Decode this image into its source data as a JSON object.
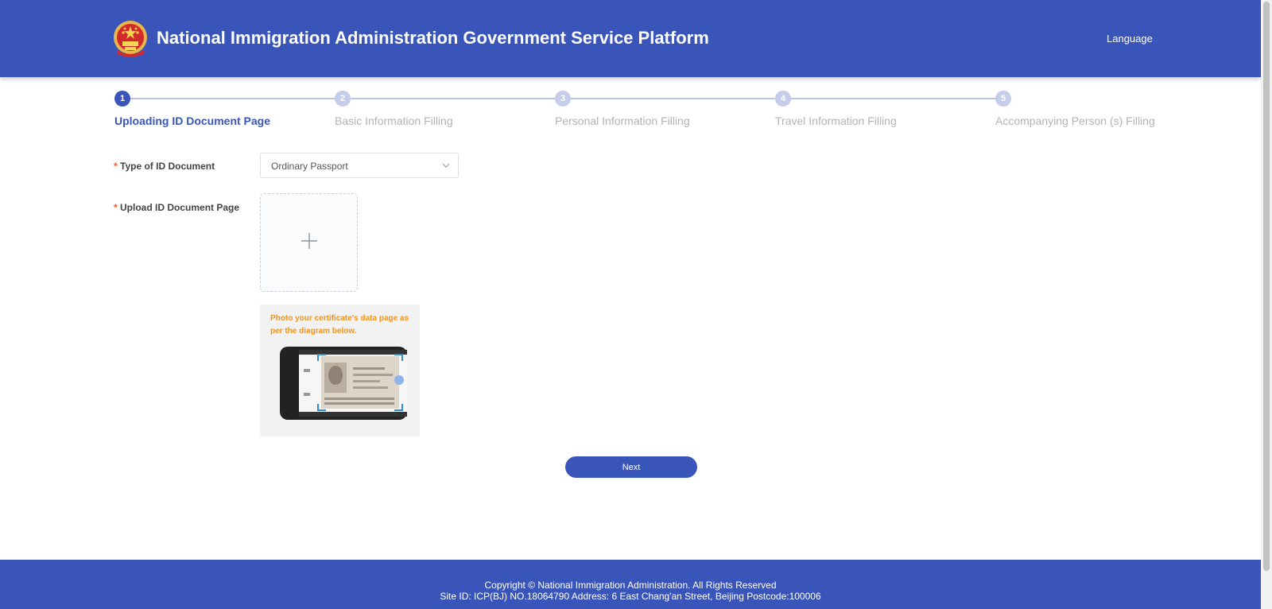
{
  "header": {
    "title": "National Immigration Administration Government Service Platform",
    "language_label": "Language",
    "emblem_icon": "national-emblem-icon",
    "background_color": "#3a55b9"
  },
  "steps": [
    {
      "number": "1",
      "label": "Uploading ID Document Page",
      "state": "active"
    },
    {
      "number": "2",
      "label": "Basic Information Filling",
      "state": "inactive"
    },
    {
      "number": "3",
      "label": "Personal Information Filling",
      "state": "inactive"
    },
    {
      "number": "4",
      "label": "Travel Information Filling",
      "state": "inactive"
    },
    {
      "number": "5",
      "label": "Accompanying Person (s) Filling",
      "state": "inactive"
    }
  ],
  "form": {
    "required_mark": "*",
    "document_type": {
      "label": "Type of ID Document",
      "value": "Ordinary Passport"
    },
    "upload": {
      "label": "Upload ID Document Page",
      "icon": "plus-icon"
    },
    "guide": {
      "text": "Photo your certificate's data page as per the diagram below.",
      "illustration": "phone-scanning-passport-illustration"
    },
    "next_label": "Next"
  },
  "footer": {
    "copyright": "Copyright © National Immigration Administration. All Rights Reserved",
    "site_info": "Site ID: ICP(BJ) NO.18064790 Address: 6 East Chang'an Street, Beijing Postcode:100006"
  },
  "colors": {
    "primary": "#3a55b9",
    "step_inactive": "#c6cdea",
    "required": "#e65a2a",
    "guide_text": "#f0941e"
  }
}
